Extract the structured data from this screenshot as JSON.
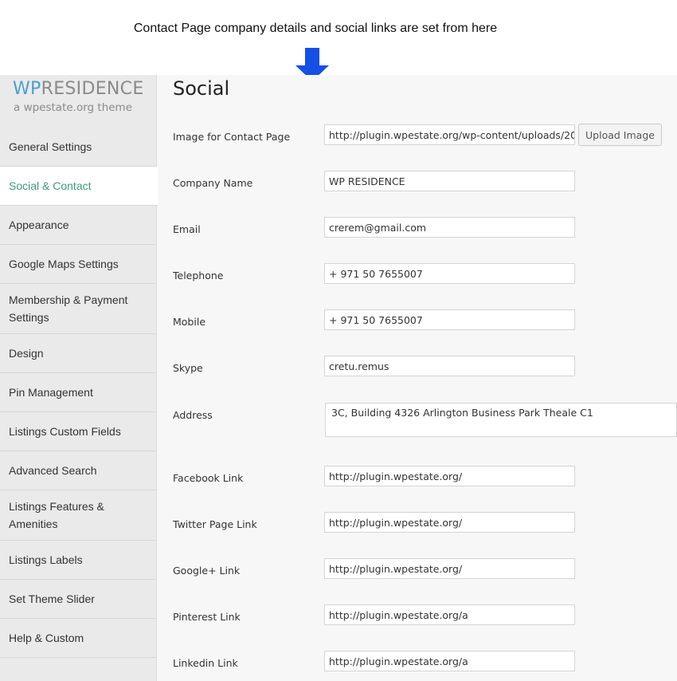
{
  "annotation": {
    "text": "Contact Page company details and social links are set from here"
  },
  "colors": {
    "arrow": "#1450e6",
    "accent_active": "#3a9e7a",
    "logo_wp": "#4a9fd0"
  },
  "logo": {
    "brand_wp": "WP",
    "brand_rest": "RESIDENCE",
    "tagline": "a wpestate.org theme"
  },
  "sidebar": {
    "items": [
      {
        "label": "General Settings"
      },
      {
        "label": "Social & Contact",
        "active": true
      },
      {
        "label": "Appearance"
      },
      {
        "label": "Google Maps Settings"
      },
      {
        "label": "Membership & Payment Settings"
      },
      {
        "label": "Design"
      },
      {
        "label": "Pin Management"
      },
      {
        "label": "Listings Custom Fields"
      },
      {
        "label": "Advanced Search"
      },
      {
        "label": "Listings Features & Amenities"
      },
      {
        "label": "Listings Labels"
      },
      {
        "label": "Set Theme Slider"
      },
      {
        "label": "Help & Custom"
      }
    ]
  },
  "main": {
    "title": "Social",
    "upload_button": "Upload Image",
    "fields": [
      {
        "label": "Image for Contact Page",
        "value": "http://plugin.wpestate.org/wp-content/uploads/20"
      },
      {
        "label": "Company Name",
        "value": "WP RESIDENCE"
      },
      {
        "label": "Email",
        "value": "crerem@gmail.com"
      },
      {
        "label": "Telephone",
        "value": "+ 971 50 7655007"
      },
      {
        "label": "Mobile",
        "value": "+ 971 50 7655007"
      },
      {
        "label": "Skype",
        "value": "cretu.remus"
      },
      {
        "label": "Address",
        "value": "3C, Building 4326 Arlington Business Park Theale C1"
      },
      {
        "label": "Facebook Link",
        "value": "http://plugin.wpestate.org/"
      },
      {
        "label": "Twitter Page Link",
        "value": "http://plugin.wpestate.org/"
      },
      {
        "label": "Google+ Link",
        "value": "http://plugin.wpestate.org/"
      },
      {
        "label": "Pinterest Link",
        "value": "http://plugin.wpestate.org/a"
      },
      {
        "label": "Linkedin Link",
        "value": "http://plugin.wpestate.org/a"
      }
    ]
  }
}
